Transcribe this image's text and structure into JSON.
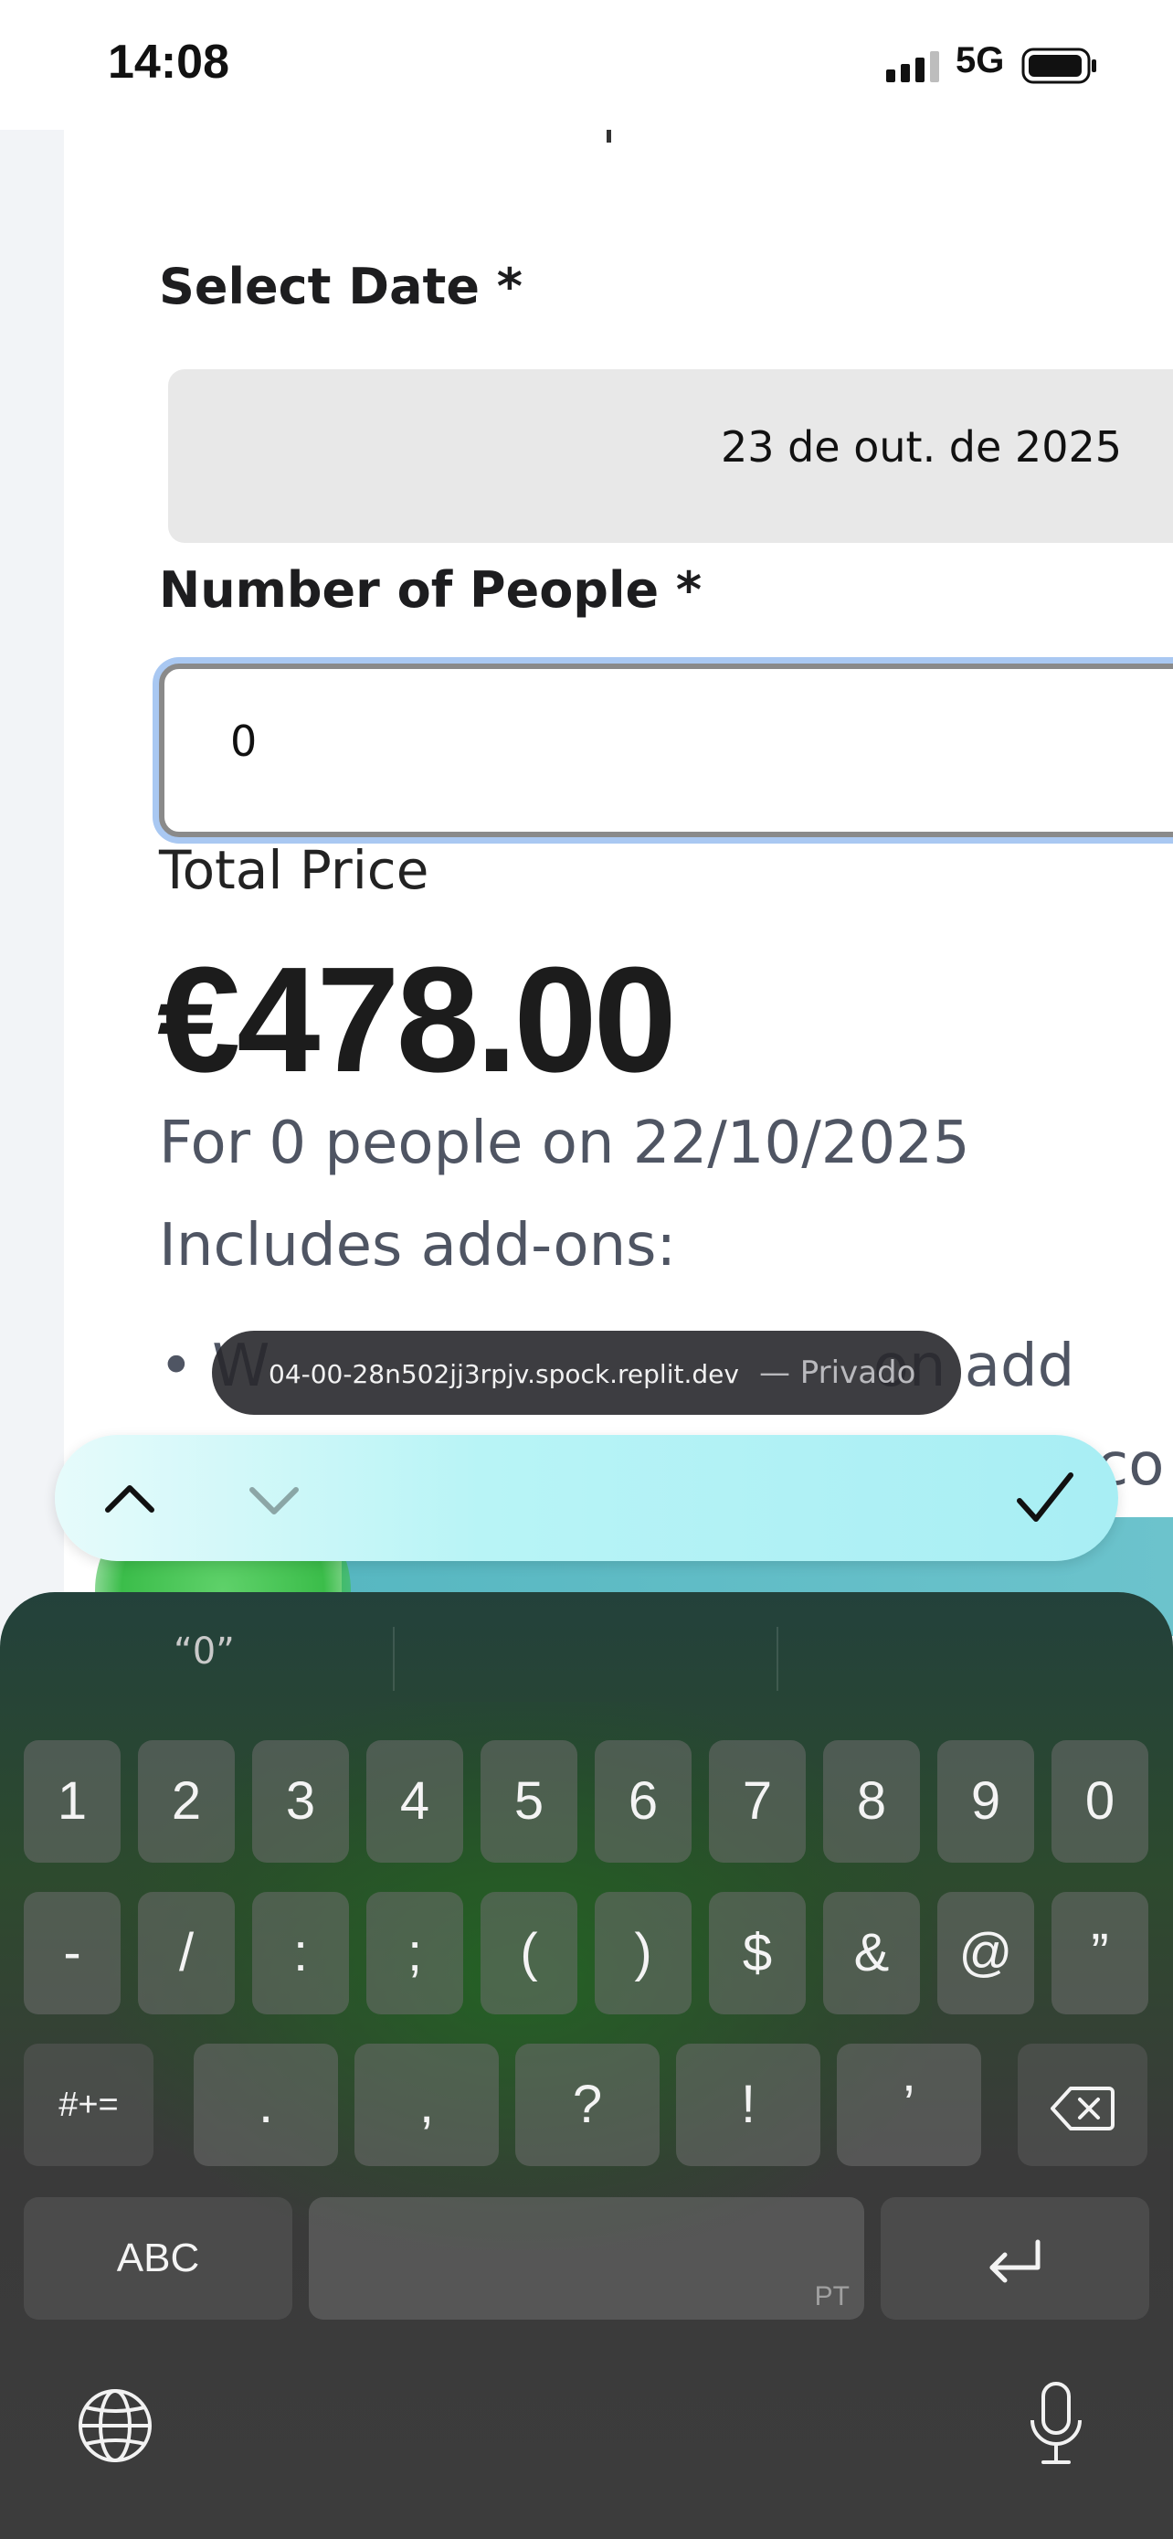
{
  "status_bar": {
    "time": "14:08",
    "network": "5G"
  },
  "form": {
    "date_label": "Select Date *",
    "date_value": "23 de out. de 2025",
    "people_label": "Number of People *",
    "people_value": "0",
    "total_label": "Total Price",
    "total_price": "€478.00",
    "summary": "For 0 people on 22/10/2025",
    "addons_label": "Includes add-ons:",
    "addon_1": "• W",
    "addon_1_tail": "on add",
    "addon_2": "co"
  },
  "browser": {
    "url": "04-00-28n502jj3rpjv.spock.replit.dev",
    "mode": "— Privado"
  },
  "keyboard": {
    "suggestion": "“0”",
    "row1": [
      "1",
      "2",
      "3",
      "4",
      "5",
      "6",
      "7",
      "8",
      "9",
      "0"
    ],
    "row2": [
      "-",
      "/",
      ":",
      ";",
      "(",
      ")",
      "$",
      "&",
      "@",
      "”"
    ],
    "row3_left": "#+=",
    "row3": [
      ".",
      ",",
      "?",
      "!",
      "’"
    ],
    "abc_label": "ABC",
    "space_lang": "PT"
  }
}
